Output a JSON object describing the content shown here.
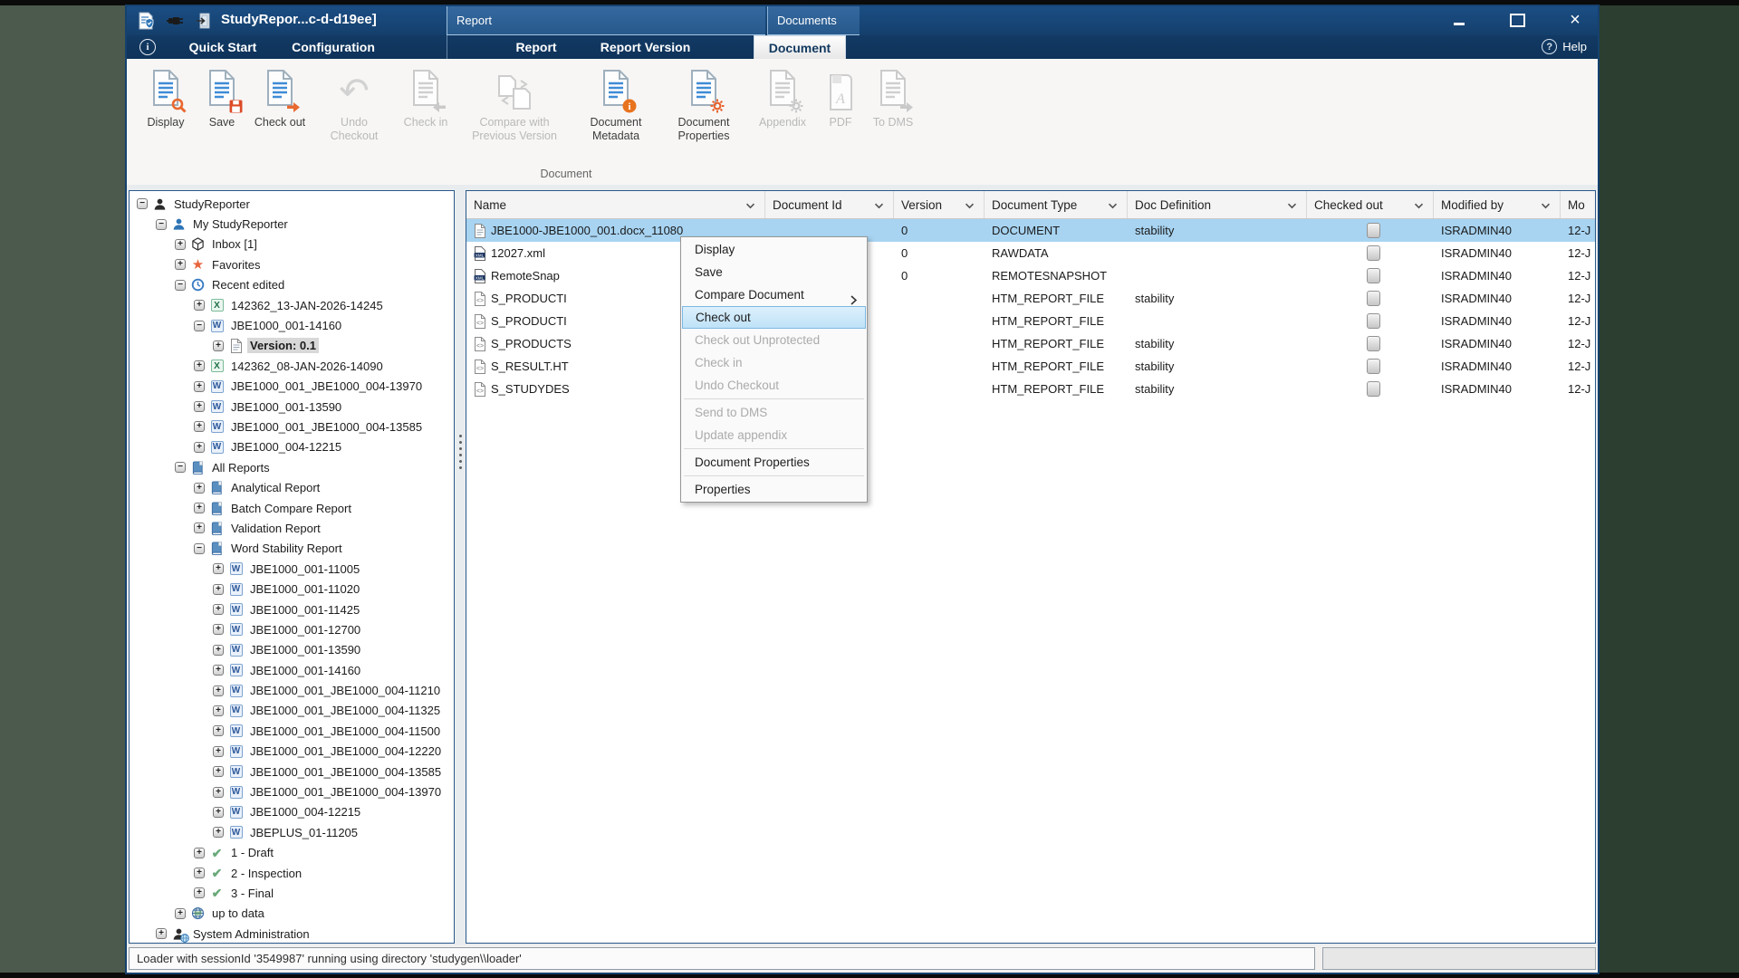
{
  "window": {
    "title": "StudyRepor...c-d-d19ee]"
  },
  "contextual_groups": {
    "report": "Report",
    "documents": "Documents"
  },
  "tabs": [
    {
      "label": "Quick Start",
      "active": false
    },
    {
      "label": "Configuration",
      "active": false
    },
    {
      "label": "Report",
      "active": false
    },
    {
      "label": "Report Version",
      "active": false
    },
    {
      "label": "Document",
      "active": true
    }
  ],
  "help_label": "Help",
  "ribbon": {
    "group_label": "Document",
    "buttons": [
      {
        "label": "Display",
        "icon": "doc-search",
        "enabled": true
      },
      {
        "label": "Save",
        "icon": "doc-save",
        "enabled": true
      },
      {
        "label": "Check out",
        "icon": "doc-checkout",
        "enabled": true
      },
      {
        "label": "Undo Checkout",
        "icon": "undo-arrow",
        "enabled": false
      },
      {
        "label": "Check in",
        "icon": "doc-checkin",
        "enabled": false
      },
      {
        "label": "Compare with Previous Version",
        "icon": "compare-docs",
        "enabled": false
      },
      {
        "label": "Document Metadata",
        "icon": "doc-info",
        "enabled": true
      },
      {
        "label": "Document Properties",
        "icon": "doc-gear",
        "enabled": true
      },
      {
        "label": "Appendix",
        "icon": "doc-gear-gray",
        "enabled": false
      },
      {
        "label": "PDF",
        "icon": "pdf-doc",
        "enabled": false
      },
      {
        "label": "To DMS",
        "icon": "doc-to-dms",
        "enabled": false
      }
    ]
  },
  "tree": {
    "items": [
      {
        "label": "StudyReporter",
        "depth": 0,
        "expander": "minus",
        "icon": "person-dark",
        "selected": false
      },
      {
        "label": "My StudyReporter",
        "depth": 1,
        "expander": "minus",
        "icon": "person-blue",
        "selected": false
      },
      {
        "label": "Inbox [1]",
        "depth": 2,
        "expander": "plus",
        "icon": "package",
        "selected": false
      },
      {
        "label": "Favorites",
        "depth": 2,
        "expander": "plus",
        "icon": "star",
        "selected": false
      },
      {
        "label": "Recent edited",
        "depth": 2,
        "expander": "minus",
        "icon": "history",
        "selected": false
      },
      {
        "label": "142362_13-JAN-2026-14245",
        "depth": 3,
        "expander": "plus",
        "icon": "excel",
        "selected": false
      },
      {
        "label": "JBE1000_001-14160",
        "depth": 3,
        "expander": "minus",
        "icon": "word",
        "selected": false
      },
      {
        "label": "Version: 0.1",
        "depth": 4,
        "expander": "plus",
        "icon": "document",
        "selected": true
      },
      {
        "label": "142362_08-JAN-2026-14090",
        "depth": 3,
        "expander": "plus",
        "icon": "excel",
        "selected": false
      },
      {
        "label": "JBE1000_001_JBE1000_004-13970",
        "depth": 3,
        "expander": "plus",
        "icon": "word",
        "selected": false
      },
      {
        "label": "JBE1000_001-13590",
        "depth": 3,
        "expander": "plus",
        "icon": "word",
        "selected": false
      },
      {
        "label": "JBE1000_001_JBE1000_004-13585",
        "depth": 3,
        "expander": "plus",
        "icon": "word",
        "selected": false
      },
      {
        "label": "JBE1000_004-12215",
        "depth": 3,
        "expander": "plus",
        "icon": "word",
        "selected": false
      },
      {
        "label": "All Reports",
        "depth": 2,
        "expander": "minus",
        "icon": "book",
        "selected": false
      },
      {
        "label": "Analytical Report",
        "depth": 3,
        "expander": "plus",
        "icon": "book",
        "selected": false
      },
      {
        "label": "Batch Compare Report",
        "depth": 3,
        "expander": "plus",
        "icon": "book",
        "selected": false
      },
      {
        "label": "Validation Report",
        "depth": 3,
        "expander": "plus",
        "icon": "book",
        "selected": false
      },
      {
        "label": "Word Stability Report",
        "depth": 3,
        "expander": "minus",
        "icon": "book",
        "selected": false
      },
      {
        "label": "JBE1000_001-11005",
        "depth": 4,
        "expander": "plus",
        "icon": "word",
        "selected": false
      },
      {
        "label": "JBE1000_001-11020",
        "depth": 4,
        "expander": "plus",
        "icon": "word",
        "selected": false
      },
      {
        "label": "JBE1000_001-11425",
        "depth": 4,
        "expander": "plus",
        "icon": "word",
        "selected": false
      },
      {
        "label": "JBE1000_001-12700",
        "depth": 4,
        "expander": "plus",
        "icon": "word",
        "selected": false
      },
      {
        "label": "JBE1000_001-13590",
        "depth": 4,
        "expander": "plus",
        "icon": "word",
        "selected": false
      },
      {
        "label": "JBE1000_001-14160",
        "depth": 4,
        "expander": "plus",
        "icon": "word",
        "selected": false
      },
      {
        "label": "JBE1000_001_JBE1000_004-11210",
        "depth": 4,
        "expander": "plus",
        "icon": "word",
        "selected": false
      },
      {
        "label": "JBE1000_001_JBE1000_004-11325",
        "depth": 4,
        "expander": "plus",
        "icon": "word",
        "selected": false
      },
      {
        "label": "JBE1000_001_JBE1000_004-11500",
        "depth": 4,
        "expander": "plus",
        "icon": "word",
        "selected": false
      },
      {
        "label": "JBE1000_001_JBE1000_004-12220",
        "depth": 4,
        "expander": "plus",
        "icon": "word",
        "selected": false
      },
      {
        "label": "JBE1000_001_JBE1000_004-13585",
        "depth": 4,
        "expander": "plus",
        "icon": "word",
        "selected": false
      },
      {
        "label": "JBE1000_001_JBE1000_004-13970",
        "depth": 4,
        "expander": "plus",
        "icon": "word",
        "selected": false
      },
      {
        "label": "JBE1000_004-12215",
        "depth": 4,
        "expander": "plus",
        "icon": "word",
        "selected": false
      },
      {
        "label": "JBEPLUS_01-11205",
        "depth": 4,
        "expander": "plus",
        "icon": "word",
        "selected": false
      },
      {
        "label": "1 - Draft",
        "depth": 3,
        "expander": "plus",
        "icon": "check",
        "selected": false
      },
      {
        "label": "2 - Inspection",
        "depth": 3,
        "expander": "plus",
        "icon": "check",
        "selected": false
      },
      {
        "label": "3 - Final",
        "depth": 3,
        "expander": "plus",
        "icon": "check",
        "selected": false
      },
      {
        "label": "up to data",
        "depth": 2,
        "expander": "plus",
        "icon": "globe",
        "selected": false
      },
      {
        "label": "System Administration",
        "depth": 1,
        "expander": "plus",
        "icon": "admin",
        "selected": false
      }
    ]
  },
  "table": {
    "columns": [
      {
        "label": "Name",
        "sortable": true
      },
      {
        "label": "Document Id",
        "sortable": true
      },
      {
        "label": "Version",
        "sortable": true
      },
      {
        "label": "Document Type",
        "sortable": true
      },
      {
        "label": "Doc Definition",
        "sortable": true
      },
      {
        "label": "Checked out",
        "sortable": true
      },
      {
        "label": "Modified by",
        "sortable": true
      },
      {
        "label": "Mo",
        "sortable": false
      }
    ],
    "rows": [
      {
        "name": "JBE1000-JBE1000_001.docx_11080",
        "icon": "doc",
        "document_id": "",
        "version": "0",
        "document_type": "DOCUMENT",
        "doc_definition": "stability",
        "checked_out": false,
        "modified_by": "ISRADMIN40",
        "modified_on": "12-J",
        "selected": true
      },
      {
        "name": "12027.xml",
        "icon": "xml",
        "document_id": "",
        "version": "0",
        "document_type": "RAWDATA",
        "doc_definition": "",
        "checked_out": false,
        "modified_by": "ISRADMIN40",
        "modified_on": "12-J",
        "selected": false
      },
      {
        "name": "RemoteSnap",
        "icon": "xml",
        "document_id": "",
        "version": "0",
        "document_type": "REMOTESNAPSHOT",
        "doc_definition": "",
        "checked_out": false,
        "modified_by": "ISRADMIN40",
        "modified_on": "12-J",
        "selected": false
      },
      {
        "name": "S_PRODUCTI",
        "icon": "code",
        "document_id": "",
        "version": "",
        "document_type": "HTM_REPORT_FILE",
        "doc_definition": "stability",
        "checked_out": false,
        "modified_by": "ISRADMIN40",
        "modified_on": "12-J",
        "selected": false
      },
      {
        "name": "S_PRODUCTI",
        "icon": "code",
        "document_id": "",
        "version": "",
        "document_type": "HTM_REPORT_FILE",
        "doc_definition": "",
        "checked_out": false,
        "modified_by": "ISRADMIN40",
        "modified_on": "12-J",
        "selected": false
      },
      {
        "name": "S_PRODUCTS",
        "icon": "code",
        "document_id": "",
        "version": "",
        "document_type": "HTM_REPORT_FILE",
        "doc_definition": "stability",
        "checked_out": false,
        "modified_by": "ISRADMIN40",
        "modified_on": "12-J",
        "selected": false
      },
      {
        "name": "S_RESULT.HT",
        "icon": "code",
        "document_id": "",
        "version": "",
        "document_type": "HTM_REPORT_FILE",
        "doc_definition": "stability",
        "checked_out": false,
        "modified_by": "ISRADMIN40",
        "modified_on": "12-J",
        "selected": false
      },
      {
        "name": "S_STUDYDES",
        "icon": "code",
        "document_id": "",
        "version": "",
        "document_type": "HTM_REPORT_FILE",
        "doc_definition": "stability",
        "checked_out": false,
        "modified_by": "ISRADMIN40",
        "modified_on": "12-J",
        "selected": false
      }
    ]
  },
  "context_menu": {
    "items": [
      {
        "type": "item",
        "label": "Display",
        "state": "enabled",
        "submenu": false
      },
      {
        "type": "item",
        "label": "Save",
        "state": "enabled",
        "submenu": false
      },
      {
        "type": "item",
        "label": "Compare Document",
        "state": "enabled",
        "submenu": true
      },
      {
        "type": "item",
        "label": "Check out",
        "state": "highlighted",
        "submenu": false
      },
      {
        "type": "item",
        "label": "Check out Unprotected",
        "state": "disabled",
        "submenu": false
      },
      {
        "type": "item",
        "label": "Check in",
        "state": "disabled",
        "submenu": false
      },
      {
        "type": "item",
        "label": "Undo Checkout",
        "state": "disabled",
        "submenu": false
      },
      {
        "type": "separator"
      },
      {
        "type": "item",
        "label": "Send to DMS",
        "state": "disabled",
        "submenu": false
      },
      {
        "type": "item",
        "label": "Update appendix",
        "state": "disabled",
        "submenu": false
      },
      {
        "type": "separator"
      },
      {
        "type": "item",
        "label": "Document Properties",
        "state": "enabled",
        "submenu": false
      },
      {
        "type": "separator"
      },
      {
        "type": "item",
        "label": "Properties",
        "state": "enabled",
        "submenu": false
      }
    ]
  },
  "status_bar": {
    "message": "Loader with sessionId '3549987' running using directory 'studygen\\\\loader'"
  },
  "colors": {
    "titlebar_blue": "#1b4e84",
    "accent_orange": "#e8682f",
    "selection_blue": "#a8d4f2",
    "menu_highlight": "#cfe7fb",
    "word_blue": "#2b579a",
    "excel_green": "#1e7145"
  }
}
